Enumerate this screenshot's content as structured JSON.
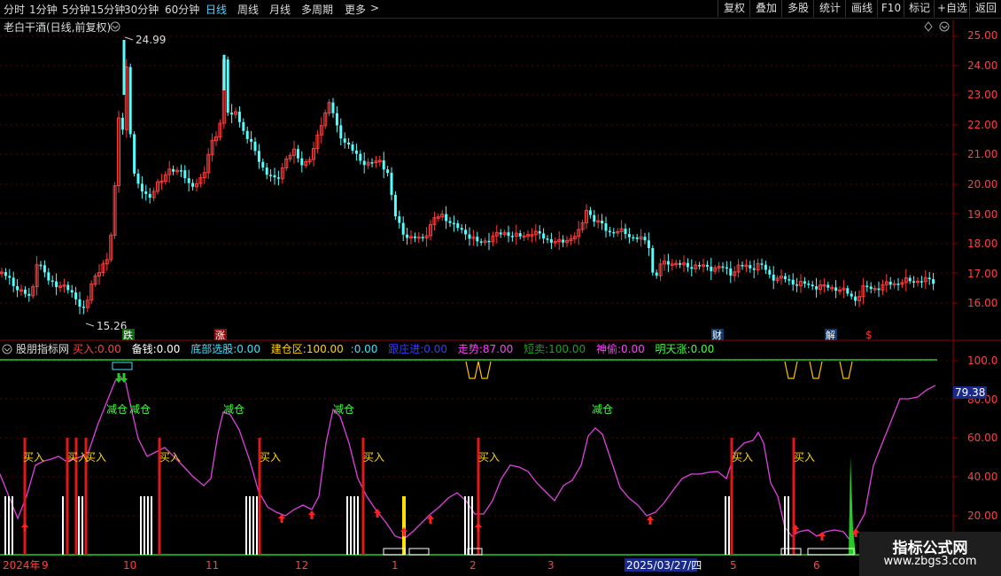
{
  "toolbar": {
    "periods": [
      "分时",
      "1分钟",
      "5分钟",
      "15分钟",
      "30分钟",
      "60分钟",
      "日线",
      "周线",
      "月线",
      "多周期",
      "更多"
    ],
    "active_period": "日线",
    "more_arrow": ">",
    "right_buttons": [
      "复权",
      "叠加",
      "多股",
      "统计",
      "画线",
      "F10",
      "标记",
      "+自选",
      "返回"
    ]
  },
  "main_chart": {
    "title": "老白干酒(日线,前复权)",
    "price_axis": [
      "25.00",
      "24.00",
      "23.00",
      "22.00",
      "21.00",
      "20.00",
      "19.00",
      "18.00",
      "17.00",
      "16.00"
    ],
    "high_label": "24.99",
    "low_label": "15.26",
    "markers": [
      "跌",
      "涨",
      "财",
      "解",
      "$"
    ],
    "colors": {
      "up": "#ff3c3c",
      "down": "#54ffff",
      "grid": "#5a0000"
    }
  },
  "indicator": {
    "name": "股朋指标网",
    "legend": [
      {
        "label": "买入:",
        "value": "0.00",
        "color": "#ff4040"
      },
      {
        "label": "备钱:",
        "value": "0.00",
        "color": "#ffffff"
      },
      {
        "label": "底部选股:",
        "value": "0.00",
        "color": "#40e0ff"
      },
      {
        "label": "建仓区:",
        "value": "100.00",
        "color": "#ffd400"
      },
      {
        "label": ":",
        "value": "0.00",
        "color": "#40e0ff"
      },
      {
        "label": "跟庄进:",
        "value": "0.00",
        "color": "#3a3aff"
      },
      {
        "label": "走势:",
        "value": "87.00",
        "color": "#ff40ff"
      },
      {
        "label": "短卖:",
        "value": "100.00",
        "color": "#20a020"
      },
      {
        "label": "神偷:",
        "value": "0.00",
        "color": "#ff40ff"
      },
      {
        "label": "明天涨:",
        "value": "0.00",
        "color": "#40ff40"
      }
    ],
    "axis": [
      "100.0",
      "80.00",
      "60.00",
      "40.00",
      "20.00"
    ],
    "current_value": "79.38",
    "buy_text": "买入",
    "reduce_text": "减仓"
  },
  "date_axis": [
    "2024年",
    "9",
    "10",
    "11",
    "12",
    "1",
    "2",
    "3",
    "2025/03/27/四",
    "5",
    "6"
  ],
  "watermark": {
    "line1": "指标公式网",
    "line2": "www.zbgs3.com"
  }
}
